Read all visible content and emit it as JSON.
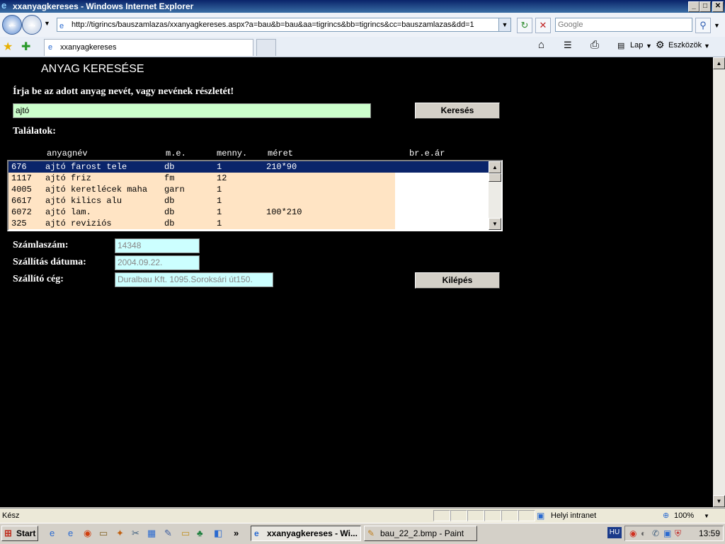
{
  "window": {
    "title": "xxanyagkereses - Windows Internet Explorer",
    "min": "_",
    "max": "□",
    "close": "✕"
  },
  "browser": {
    "back": "←",
    "forward": "→",
    "url": "http://tigrincs/bauszamlazas/xxanyagkereses.aspx?a=bau&b=bau&aa=tigrincs&bb=tigrincs&cc=bauszamlazas&dd=1",
    "refresh": "↻",
    "stop": "✕",
    "search_placeholder": "Google",
    "search_go": "⚲",
    "tab_title": "xxanyagkereses",
    "fav_star": "★",
    "add_fav": "✚",
    "home": "⌂",
    "feeds": "☰",
    "print": "⎙",
    "page_menu": "Lap",
    "tools_menu": "Eszközök"
  },
  "page": {
    "heading": "ANYAG KERESÉSE",
    "prompt": "Írja be az adott anyag nevét, vagy nevének részletét!",
    "query": "ajtó",
    "search_button": "Keresés",
    "results_label": "Találatok:",
    "columns": {
      "name": "anyagnév",
      "unit": "m.e.",
      "qty": "menny.",
      "size": "méret",
      "price": "br.e.ár"
    },
    "rows": [
      {
        "id": "676",
        "name": "ajtó farost tele",
        "unit": "db",
        "qty": "1",
        "size": "210*90"
      },
      {
        "id": "1117",
        "name": "ajtó friz",
        "unit": "fm",
        "qty": "12",
        "size": ""
      },
      {
        "id": "4005",
        "name": "ajtó keretlécek maha",
        "unit": "garn",
        "qty": "1",
        "size": ""
      },
      {
        "id": "6617",
        "name": "ajtó kilics alu",
        "unit": "db",
        "qty": "1",
        "size": ""
      },
      {
        "id": "6072",
        "name": "ajtó lam.",
        "unit": "db",
        "qty": "1",
        "size": "100*210"
      },
      {
        "id": "325",
        "name": "ajtó reviziós",
        "unit": "db",
        "qty": "1",
        "size": ""
      }
    ],
    "invoice_label": "Számlaszám:",
    "invoice_value": "14348",
    "date_label": "Szállítás dátuma:",
    "date_value": "2004.09.22.",
    "supplier_label": "Szállító cég:",
    "supplier_value": "Duralbau Kft. 1095.Soroksári út150.",
    "exit_button": "Kilépés"
  },
  "status": {
    "text": "Kész",
    "zone": "Helyi intranet",
    "zoom": "100%"
  },
  "taskbar": {
    "start": "Start",
    "task1": "xxanyagkereses - Wi...",
    "task2": "bau_22_2.bmp - Paint",
    "lang": "HU",
    "clock": "13:59",
    "more": "»"
  }
}
